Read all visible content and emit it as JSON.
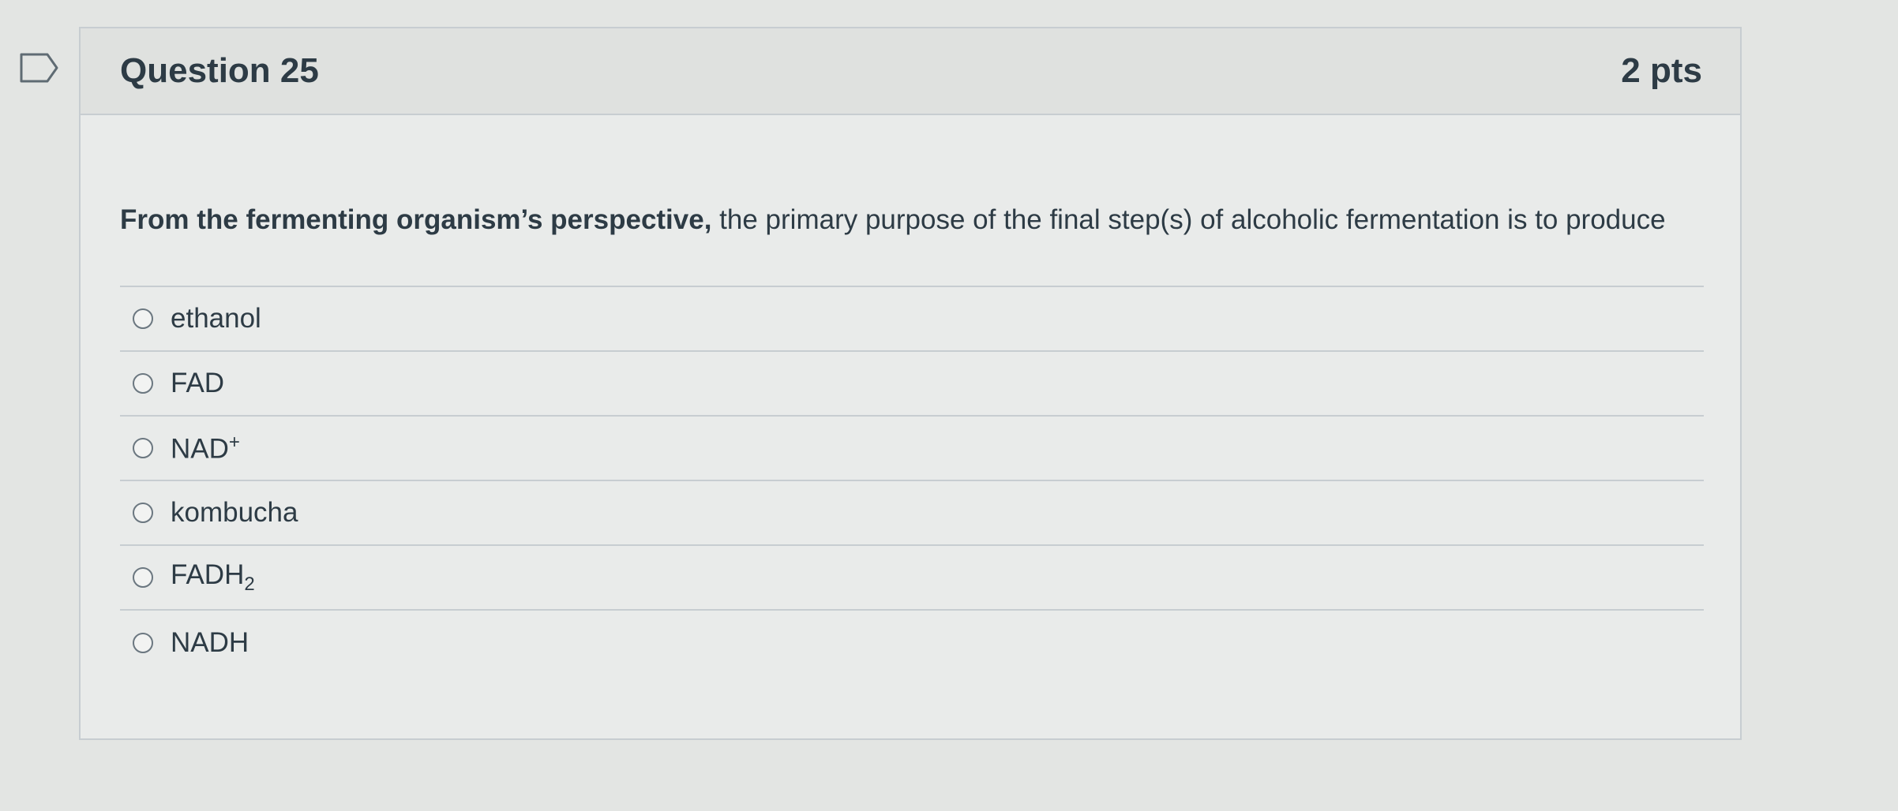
{
  "question": {
    "title": "Question 25",
    "points": "2 pts",
    "text_part1": "From the fermenting organism’s perspective,",
    "text_part2": " the primary purpose of the final step(s) of alcoholic fermentation is to produce"
  },
  "answers": [
    {
      "label": "ethanol",
      "sup": "",
      "sub": ""
    },
    {
      "label": "FAD",
      "sup": "",
      "sub": ""
    },
    {
      "label": "NAD",
      "sup": "+",
      "sub": ""
    },
    {
      "label": "kombucha",
      "sup": "",
      "sub": ""
    },
    {
      "label": "FADH",
      "sup": "",
      "sub": "2"
    },
    {
      "label": "NADH",
      "sup": "",
      "sub": ""
    }
  ],
  "icons": {
    "flag": "bookmark-flag-icon",
    "radio": "radio-unchecked-icon"
  },
  "colors": {
    "text": "#2d3b45",
    "border": "#c7cdd1",
    "header_bg": "#dfe1df",
    "body_bg": "#e9ebea"
  }
}
